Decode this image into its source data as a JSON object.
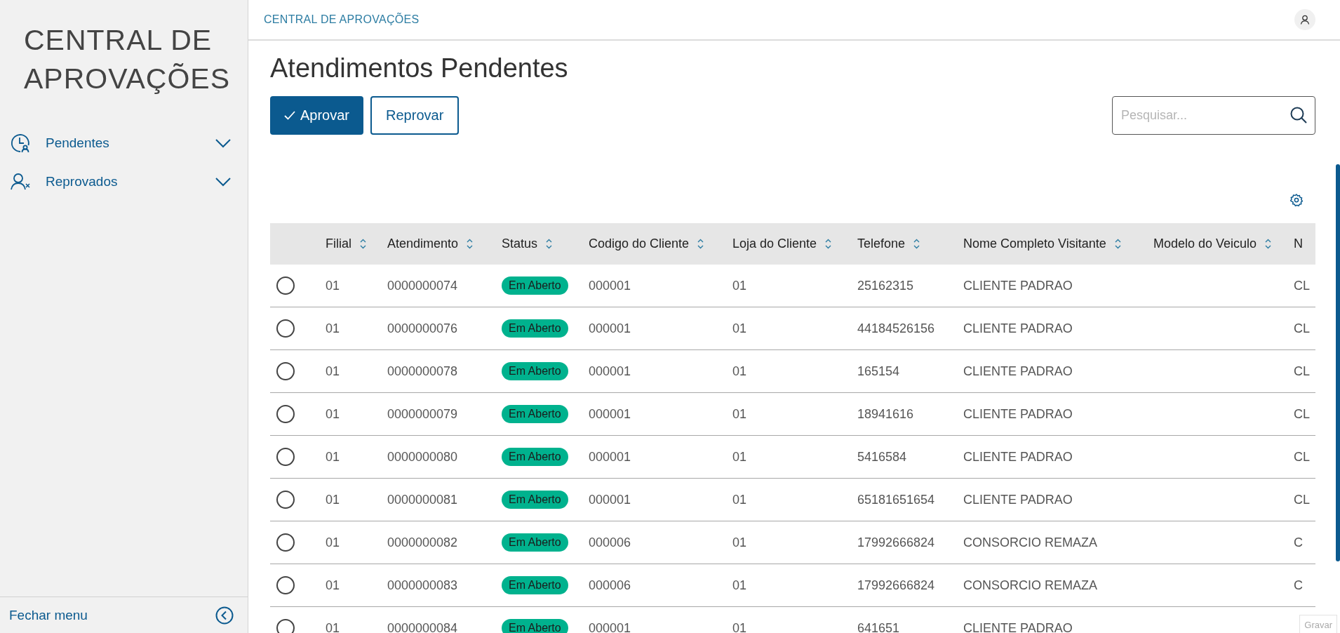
{
  "header": {
    "breadcrumb": "CENTRAL DE APROVAÇÕES"
  },
  "sidebar": {
    "title": "CENTRAL DE APROVAÇÕES",
    "items": [
      {
        "label": "Pendentes",
        "expanded": false
      },
      {
        "label": "Reprovados",
        "expanded": false
      }
    ],
    "footer": "Fechar menu"
  },
  "page": {
    "title": "Atendimentos Pendentes",
    "actions": [
      {
        "label": "Aprovar",
        "kind": "primary"
      },
      {
        "label": "Reprovar",
        "kind": "secondary"
      }
    ],
    "search": {
      "placeholder": "Pesquisar..."
    }
  },
  "table": {
    "columns": [
      {
        "label": "Filial",
        "sortable": true
      },
      {
        "label": "Atendimento",
        "sortable": true
      },
      {
        "label": "Status",
        "sortable": true
      },
      {
        "label": "Codigo do Cliente",
        "sortable": true
      },
      {
        "label": "Loja do Cliente",
        "sortable": true
      },
      {
        "label": "Telefone",
        "sortable": true
      },
      {
        "label": "Nome Completo Visitante",
        "sortable": true
      },
      {
        "label": "Modelo do Veiculo",
        "sortable": true
      },
      {
        "label": "N",
        "sortable": false
      }
    ],
    "rows": [
      {
        "selected": false,
        "cells": [
          "01",
          "0000000074",
          "Em Aberto",
          "000001",
          "01",
          "25162315",
          "CLIENTE PADRAO",
          "",
          "CL"
        ]
      },
      {
        "selected": false,
        "cells": [
          "01",
          "0000000076",
          "Em Aberto",
          "000001",
          "01",
          "44184526156",
          "CLIENTE PADRAO",
          "",
          "CL"
        ]
      },
      {
        "selected": false,
        "cells": [
          "01",
          "0000000078",
          "Em Aberto",
          "000001",
          "01",
          "165154",
          "CLIENTE PADRAO",
          "",
          "CL"
        ]
      },
      {
        "selected": false,
        "cells": [
          "01",
          "0000000079",
          "Em Aberto",
          "000001",
          "01",
          "18941616",
          "CLIENTE PADRAO",
          "",
          "CL"
        ]
      },
      {
        "selected": false,
        "cells": [
          "01",
          "0000000080",
          "Em Aberto",
          "000001",
          "01",
          "5416584",
          "CLIENTE PADRAO",
          "",
          "CL"
        ]
      },
      {
        "selected": false,
        "cells": [
          "01",
          "0000000081",
          "Em Aberto",
          "000001",
          "01",
          "65181651654",
          "CLIENTE PADRAO",
          "",
          "CL"
        ]
      },
      {
        "selected": false,
        "cells": [
          "01",
          "0000000082",
          "Em Aberto",
          "000006",
          "01",
          "17992666824",
          "CONSORCIO REMAZA",
          "",
          "C"
        ]
      },
      {
        "selected": false,
        "cells": [
          "01",
          "0000000083",
          "Em Aberto",
          "000006",
          "01",
          "17992666824",
          "CONSORCIO REMAZA",
          "",
          "C"
        ]
      },
      {
        "selected": false,
        "cells": [
          "01",
          "0000000084",
          "Em Aberto",
          "000001",
          "01",
          "641651",
          "CLIENTE PADRAO",
          ""
        ]
      }
    ]
  },
  "overlay": {
    "label": "Gravar"
  }
}
